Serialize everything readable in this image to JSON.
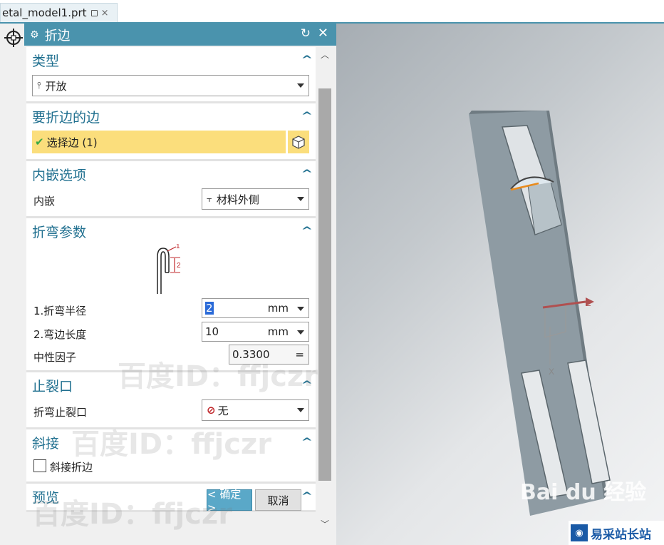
{
  "tab": {
    "title": "etal_model1.prt",
    "close": "×"
  },
  "dialog": {
    "title": "折边",
    "sections": {
      "type": {
        "title": "类型",
        "value": "开放"
      },
      "edge": {
        "title": "要折边的边",
        "select_label": "选择边 (1)"
      },
      "inset": {
        "title": "内嵌选项",
        "label": "内嵌",
        "value": "材料外侧"
      },
      "bend": {
        "title": "折弯参数",
        "diagram_marks": [
          "1",
          "2"
        ],
        "radius": {
          "label": "1.折弯半径",
          "value": "2",
          "unit": "mm"
        },
        "flange": {
          "label": "2.弯边长度",
          "value": "10",
          "unit": "mm"
        },
        "neutral": {
          "label": "中性因子",
          "value": "0.3300",
          "suffix": "="
        }
      },
      "relief": {
        "title": "止裂口",
        "label": "折弯止裂口",
        "value": "无"
      },
      "miter": {
        "title": "斜接",
        "checkbox_label": "斜接折边"
      },
      "preview": {
        "title": "预览"
      }
    },
    "buttons": {
      "ok": "< 确定 >",
      "cancel": "取消"
    }
  },
  "viewport": {
    "axis_labels": {
      "z": "Z",
      "x": "X"
    },
    "part_color": "#8e9ba3"
  },
  "watermarks": [
    "百度ID：ffjczr",
    "百度ID：ffjczr",
    "百度ID：ffjczr"
  ],
  "logos": {
    "baidu": "Bai du 经验",
    "site": "易采站长站"
  },
  "colors": {
    "accent": "#4a93ad",
    "selection": "#fbde7c",
    "ok": "#5aa8c8"
  }
}
